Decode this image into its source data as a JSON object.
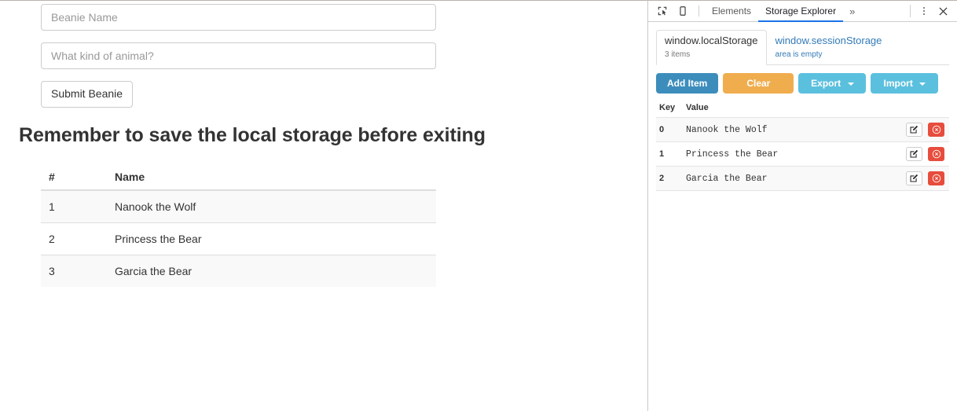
{
  "page": {
    "form": {
      "name_placeholder": "Beanie Name",
      "animal_placeholder": "What kind of animal?",
      "submit_label": "Submit Beanie"
    },
    "heading": "Remember to save the local storage before exiting",
    "table": {
      "columns": [
        "#",
        "Name"
      ],
      "rows": [
        {
          "num": "1",
          "name": "Nanook the Wolf"
        },
        {
          "num": "2",
          "name": "Princess the Bear"
        },
        {
          "num": "3",
          "name": "Garcia the Bear"
        }
      ]
    }
  },
  "devtools": {
    "toolbar": {
      "inspect_icon": "inspect-cursor-icon",
      "device_icon": "device-toolbar-icon",
      "tabs": [
        {
          "label": "Elements",
          "active": false
        },
        {
          "label": "Storage Explorer",
          "active": true
        }
      ],
      "more_tabs": "»",
      "kebab_icon": "more-options-icon",
      "close_icon": "close-icon"
    },
    "storage": {
      "tabs": [
        {
          "title": "window.localStorage",
          "sub": "3 items",
          "active": true
        },
        {
          "title": "window.sessionStorage",
          "sub": "area is empty",
          "active": false
        }
      ],
      "buttons": [
        {
          "label": "Add Item",
          "color": "#3c8dbc",
          "caret": false,
          "name": "add-item-button"
        },
        {
          "label": "Clear",
          "color": "#f0ad4e",
          "caret": false,
          "name": "clear-button"
        },
        {
          "label": "Export",
          "color": "#5bc0de",
          "caret": true,
          "name": "export-button"
        },
        {
          "label": "Import",
          "color": "#5bc0de",
          "caret": true,
          "name": "import-button"
        }
      ],
      "columns": [
        "Key",
        "Value"
      ],
      "rows": [
        {
          "key": "0",
          "value": "Nanook the Wolf"
        },
        {
          "key": "1",
          "value": "Princess the Bear"
        },
        {
          "key": "2",
          "value": "Garcia the Bear"
        }
      ],
      "edit_icon": "edit-icon",
      "delete_icon": "delete-icon"
    }
  },
  "colors": {
    "primary": "#3c8dbc",
    "warning": "#f0ad4e",
    "info": "#5bc0de",
    "danger": "#e74c3c",
    "link": "#337ab7",
    "tab_underline": "#1a73e8"
  }
}
